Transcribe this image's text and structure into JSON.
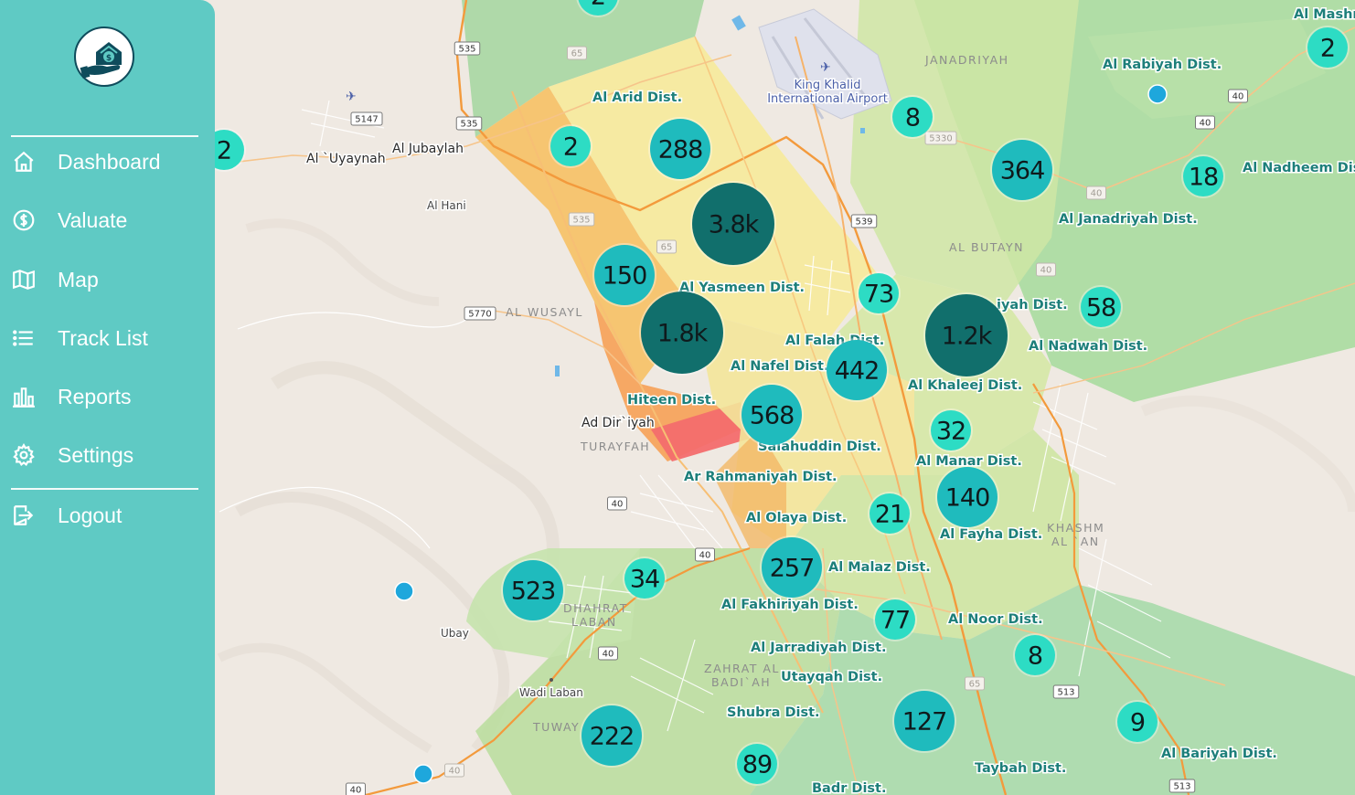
{
  "sidebar": {
    "items": [
      {
        "key": "dashboard",
        "label": "Dashboard",
        "icon": "home-icon"
      },
      {
        "key": "valuate",
        "label": "Valuate",
        "icon": "dollar-circle-icon"
      },
      {
        "key": "map",
        "label": "Map",
        "icon": "map-icon"
      },
      {
        "key": "track-list",
        "label": "Track List",
        "icon": "list-icon"
      },
      {
        "key": "reports",
        "label": "Reports",
        "icon": "bar-chart-icon"
      },
      {
        "key": "settings",
        "label": "Settings",
        "icon": "gear-icon"
      }
    ],
    "logout": {
      "label": "Logout",
      "icon": "logout-icon"
    }
  },
  "colors": {
    "sidebar_bg": "#5fcac4",
    "cluster_small": "#2ddcc4",
    "cluster_medium": "#1fbbbd",
    "cluster_large": "#116f6c",
    "point": "#1ea7dc",
    "district_label": "#1d7f7a"
  },
  "map": {
    "airport": {
      "line1": "King Khalid",
      "line2": "International Airport"
    },
    "districts": [
      {
        "name": "Al Arid Dist."
      },
      {
        "name": "Al Yasmeen Dist."
      },
      {
        "name": "Al Falah Dist."
      },
      {
        "name": "Al Nafel Dist."
      },
      {
        "name": "Hiteen Dist."
      },
      {
        "name": "Salahuddin Dist."
      },
      {
        "name": "Ar Rahmaniyah Dist."
      },
      {
        "name": "Al Olaya Dist."
      },
      {
        "name": "Al Malaz Dist."
      },
      {
        "name": "Al Fakhiriyah Dist."
      },
      {
        "name": "Al Jarradiyah Dist."
      },
      {
        "name": "Utayqah Dist."
      },
      {
        "name": "Shubra Dist."
      },
      {
        "name": "Badr Dist."
      },
      {
        "name": "Al Rabiyah Dist."
      },
      {
        "name": "Al Nadheem Dis"
      },
      {
        "name": "Al Janadriyah Dist."
      },
      {
        "name": "iyah Dist."
      },
      {
        "name": "Al Nadwah Dist."
      },
      {
        "name": "Al Khaleej Dist."
      },
      {
        "name": "Al Manar Dist."
      },
      {
        "name": "Al Fayha Dist."
      },
      {
        "name": "Al Noor Dist."
      },
      {
        "name": "Al Bariyah Dist."
      },
      {
        "name": "Taybah Dist."
      },
      {
        "name": "Al Mashr"
      }
    ],
    "places": [
      {
        "name": "Al `Uyaynah"
      },
      {
        "name": "Al Jubaylah"
      },
      {
        "name": "Al Hani"
      },
      {
        "name": "Ad Dir`iyah"
      },
      {
        "name": "Ubay"
      },
      {
        "name": "Wadi Laban"
      }
    ],
    "areas": [
      {
        "name": "JANADRIYAH"
      },
      {
        "name": "AL BUTAYN"
      },
      {
        "name": "AL WUSAYL"
      },
      {
        "name": "TURAYFAH"
      },
      {
        "name": "KHASHM"
      },
      {
        "name": "AL `AN"
      },
      {
        "name": "DHAHRAT"
      },
      {
        "name": "LABAN"
      },
      {
        "name": "ZAHRAT AL"
      },
      {
        "name": "BADI`AH"
      },
      {
        "name": "TUWAY"
      }
    ],
    "road_shields": [
      {
        "label": "535"
      },
      {
        "label": "65"
      },
      {
        "label": "5147"
      },
      {
        "label": "535"
      },
      {
        "label": "535"
      },
      {
        "label": "65"
      },
      {
        "label": "539"
      },
      {
        "label": "5330"
      },
      {
        "label": "5770"
      },
      {
        "label": "40"
      },
      {
        "label": "40"
      },
      {
        "label": "40"
      },
      {
        "label": "40"
      },
      {
        "label": "40"
      },
      {
        "label": "40"
      },
      {
        "label": "65"
      },
      {
        "label": "513"
      },
      {
        "label": "40"
      },
      {
        "label": "40"
      },
      {
        "label": "513"
      },
      {
        "label": "40"
      }
    ],
    "clusters": [
      {
        "label": "2"
      },
      {
        "label": "2"
      },
      {
        "label": "288"
      },
      {
        "label": "2"
      },
      {
        "label": "3.8k"
      },
      {
        "label": "150"
      },
      {
        "label": "1.8k"
      },
      {
        "label": "8"
      },
      {
        "label": "364"
      },
      {
        "label": "2"
      },
      {
        "label": "18"
      },
      {
        "label": "73"
      },
      {
        "label": "1.2k"
      },
      {
        "label": "58"
      },
      {
        "label": "442"
      },
      {
        "label": "568"
      },
      {
        "label": "32"
      },
      {
        "label": "140"
      },
      {
        "label": "21"
      },
      {
        "label": "257"
      },
      {
        "label": "34"
      },
      {
        "label": "523"
      },
      {
        "label": "77"
      },
      {
        "label": "8"
      },
      {
        "label": "127"
      },
      {
        "label": "9"
      },
      {
        "label": "222"
      },
      {
        "label": "89"
      }
    ]
  }
}
